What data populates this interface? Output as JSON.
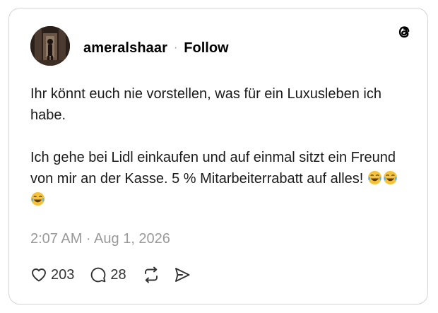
{
  "post": {
    "username": "ameralshaar",
    "separator": "·",
    "follow_label": "Follow",
    "paragraph_1": "Ihr könnt euch nie vorstellen, was für ein Luxusleben ich habe.",
    "paragraph_2": "Ich gehe bei Lidl einkaufen und auf einmal sitzt ein Freund von mir an der Kasse. 5 % Mitarbeiterrabatt auf alles!",
    "emoji": "😂😂😂",
    "timestamp": "2:07 AM · Aug 1, 2026"
  },
  "actions": {
    "likes": "203",
    "replies": "28"
  },
  "icons": {
    "logo": "threads-logo-icon",
    "like": "heart-icon",
    "reply": "comment-icon",
    "repost": "repost-icon",
    "share": "share-icon",
    "emoji": "face-with-tears-of-joy-icon"
  },
  "colors": {
    "text": "#1a1a1a",
    "muted": "#999999",
    "border": "#d4d4d4",
    "emoji_yellow": "#f5c33b"
  }
}
